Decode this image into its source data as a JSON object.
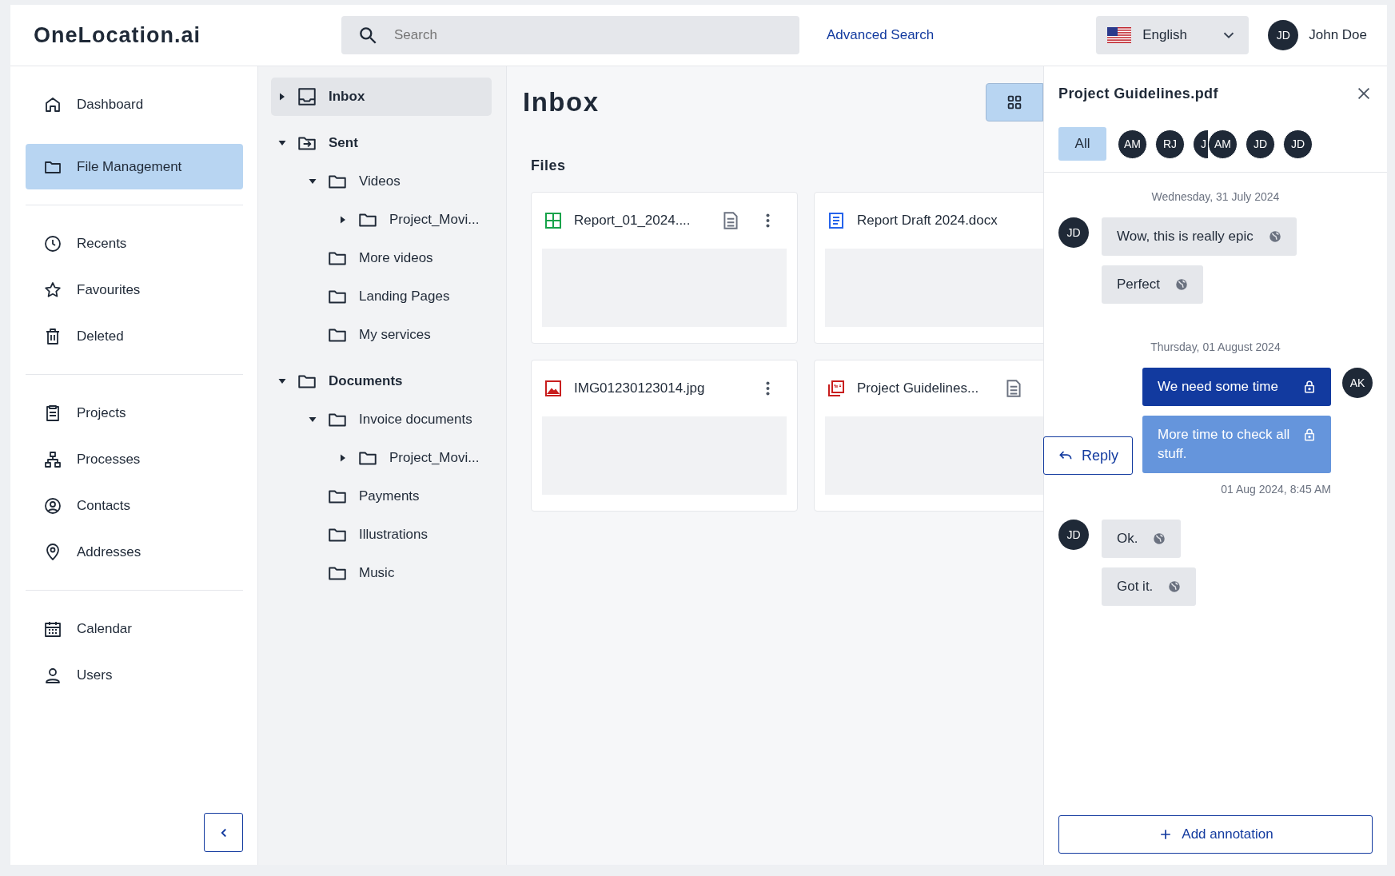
{
  "header": {
    "logo": "OneLocation.ai",
    "search": {
      "placeholder": "Search"
    },
    "advanced_search": "Advanced Search",
    "language": "English",
    "user": {
      "initials": "JD",
      "name": "John Doe"
    }
  },
  "sidebar": {
    "groups": [
      {
        "items": [
          {
            "label": "Dashboard",
            "kind": "home",
            "selected": false
          },
          {
            "label": "File Management",
            "kind": "folder",
            "selected": true
          }
        ]
      },
      {
        "items": [
          {
            "label": "Recents",
            "kind": "clock",
            "selected": false
          },
          {
            "label": "Favourites",
            "kind": "star",
            "selected": false
          },
          {
            "label": "Deleted",
            "kind": "trash",
            "selected": false
          }
        ]
      },
      {
        "items": [
          {
            "label": "Projects",
            "kind": "clipboard",
            "selected": false
          },
          {
            "label": "Processes",
            "kind": "hierarchy",
            "selected": false
          },
          {
            "label": "Contacts",
            "kind": "person-circle",
            "selected": false
          },
          {
            "label": "Addresses",
            "kind": "pin",
            "selected": false
          }
        ]
      },
      {
        "items": [
          {
            "label": "Calendar",
            "kind": "calendar",
            "selected": false
          },
          {
            "label": "Users",
            "kind": "person",
            "selected": false
          }
        ]
      }
    ]
  },
  "tree": [
    {
      "label": "Inbox",
      "kind": "inbox",
      "expanded": false,
      "selected": true
    },
    {
      "label": "Sent",
      "kind": "sent",
      "expanded": true,
      "selected": false,
      "children": [
        {
          "label": "Videos",
          "kind": "folder",
          "expanded": true,
          "selected": false,
          "children": [
            {
              "label": "Project_Movi...",
              "kind": "folder",
              "expanded": false,
              "selected": false
            }
          ]
        },
        {
          "label": "More videos",
          "kind": "folder",
          "selected": false
        },
        {
          "label": "Landing Pages",
          "kind": "folder",
          "selected": false
        },
        {
          "label": "My services",
          "kind": "folder",
          "selected": false
        }
      ]
    },
    {
      "label": "Documents",
      "kind": "folder",
      "expanded": true,
      "selected": false,
      "children": [
        {
          "label": "Invoice documents",
          "kind": "folder",
          "expanded": true,
          "selected": false,
          "children": [
            {
              "label": "Project_Movi...",
              "kind": "folder",
              "expanded": false,
              "selected": false
            }
          ]
        },
        {
          "label": "Payments",
          "kind": "folder",
          "selected": false
        },
        {
          "label": "Illustrations",
          "kind": "folder",
          "selected": false
        },
        {
          "label": "Music",
          "kind": "folder",
          "selected": false
        }
      ]
    }
  ],
  "main": {
    "title": "Inbox",
    "section": "Files",
    "files": [
      {
        "name": "Report_01_2024....",
        "kind": "sheet",
        "has_note": true,
        "has_menu": true
      },
      {
        "name": "Report Draft 2024.docx",
        "kind": "doc",
        "has_note": false,
        "has_menu": false
      },
      {
        "name": "IMG01230123014.jpg",
        "kind": "image",
        "has_note": false,
        "has_menu": true
      },
      {
        "name": "Project Guidelines...",
        "kind": "pdf",
        "has_note": true,
        "has_menu": false
      }
    ]
  },
  "panel": {
    "title": "Project Guidelines.pdf",
    "filters": [
      {
        "label": "All",
        "kind": "all",
        "selected": true
      },
      {
        "label": "AM",
        "kind": "avatar",
        "selected": false
      },
      {
        "label": "RJ",
        "kind": "avatar",
        "selected": false
      },
      {
        "label": "J",
        "kind": "avatar",
        "selected": false
      },
      {
        "label": "AM",
        "kind": "avatar",
        "selected": false
      },
      {
        "label": "JD",
        "kind": "avatar",
        "selected": false
      },
      {
        "label": "JD",
        "kind": "avatar",
        "selected": false
      }
    ],
    "days": [
      {
        "date": "Wednesday, 31 July 2024",
        "groups": [
          {
            "avatar": "JD",
            "kind": "incoming",
            "messages": [
              {
                "text": "Wow, this is really epic",
                "locked": false,
                "color": "#e5e7eb"
              },
              {
                "text": "Perfect",
                "locked": false,
                "color": "#e5e7eb"
              }
            ]
          }
        ]
      },
      {
        "date": "Thursday, 01 August 2024",
        "groups": [
          {
            "avatar": "AK",
            "kind": "outgoing",
            "reply_button": "Reply",
            "timestamp": "01 Aug 2024, 8:45 AM",
            "messages": [
              {
                "text": "We need some time",
                "locked": true,
                "color": "#123a9f"
              },
              {
                "text": "More time to check all stuff.",
                "locked": true,
                "color": "#6595dc"
              }
            ]
          },
          {
            "avatar": "JD",
            "kind": "incoming",
            "messages": [
              {
                "text": "Ok.",
                "locked": false,
                "color": "#e5e7eb"
              },
              {
                "text": "Got it.",
                "locked": false,
                "color": "#e5e7eb"
              }
            ]
          }
        ]
      }
    ],
    "add_button": "Add annotation"
  }
}
